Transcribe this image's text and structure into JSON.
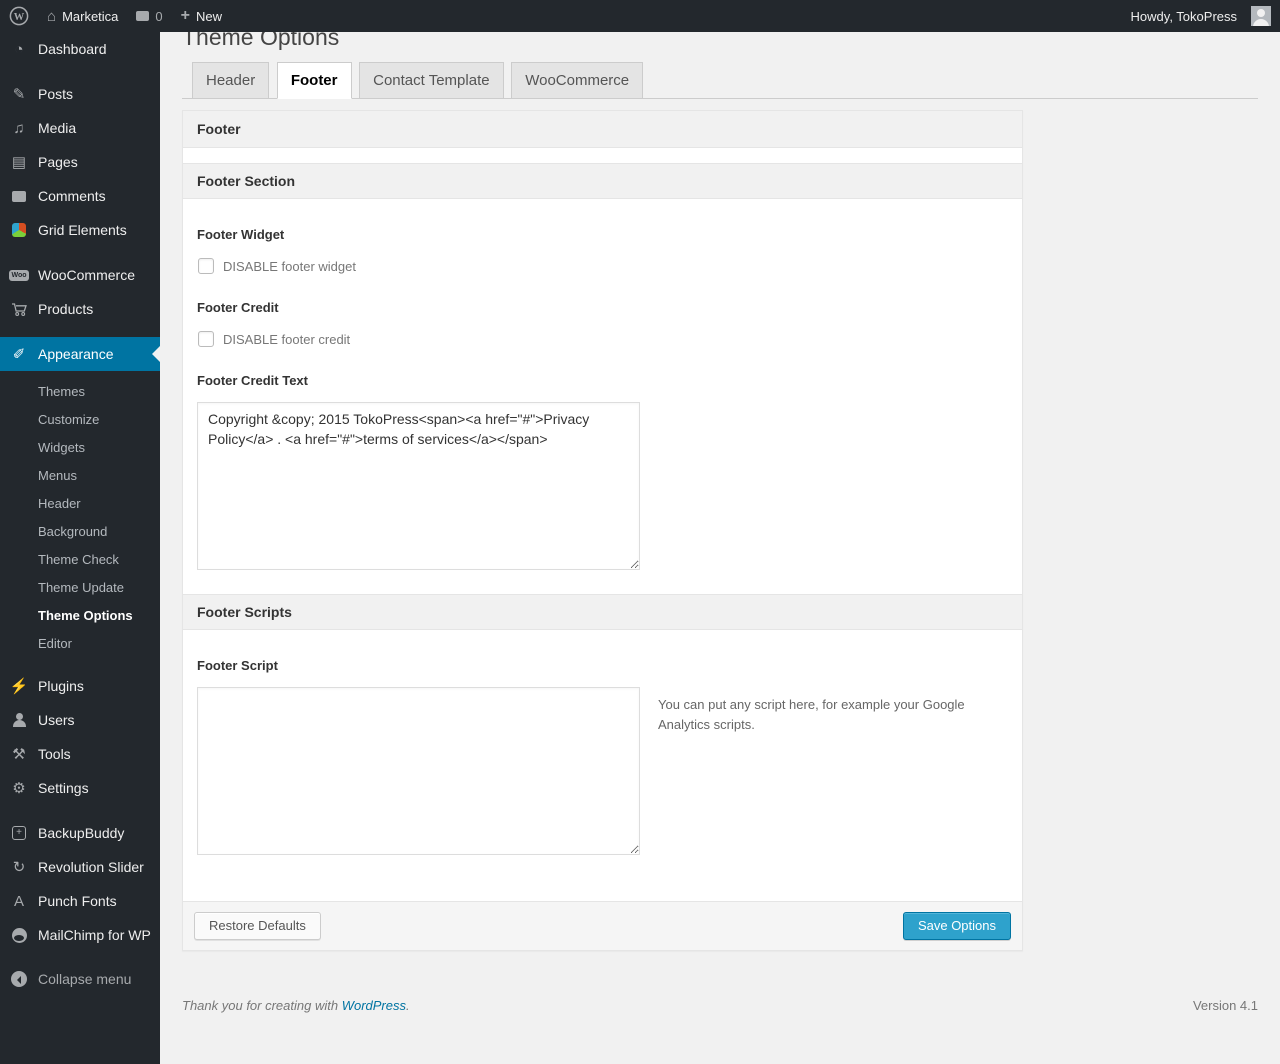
{
  "admin_bar": {
    "wp_logo_letter": "W",
    "site_name": "Marketica",
    "comments_count": "0",
    "new_label": "New",
    "howdy_text": "Howdy, TokoPress"
  },
  "sidebar": {
    "items": [
      {
        "label": "Dashboard"
      },
      {
        "label": "Posts"
      },
      {
        "label": "Media"
      },
      {
        "label": "Pages"
      },
      {
        "label": "Comments"
      },
      {
        "label": "Grid Elements"
      },
      {
        "label": "WooCommerce"
      },
      {
        "label": "Products"
      },
      {
        "label": "Appearance"
      },
      {
        "label": "Plugins"
      },
      {
        "label": "Users"
      },
      {
        "label": "Tools"
      },
      {
        "label": "Settings"
      },
      {
        "label": "BackupBuddy"
      },
      {
        "label": "Revolution Slider"
      },
      {
        "label": "Punch Fonts"
      },
      {
        "label": "MailChimp for WP"
      },
      {
        "label": "Collapse menu"
      }
    ],
    "woo_badge": "Woo",
    "punch_icon_letter": "A",
    "backup_icon_glyph": "+",
    "appearance_submenu": [
      {
        "label": "Themes"
      },
      {
        "label": "Customize"
      },
      {
        "label": "Widgets"
      },
      {
        "label": "Menus"
      },
      {
        "label": "Header"
      },
      {
        "label": "Background"
      },
      {
        "label": "Theme Check"
      },
      {
        "label": "Theme Update"
      },
      {
        "label": "Theme Options"
      },
      {
        "label": "Editor"
      }
    ]
  },
  "page": {
    "title": "Theme Options",
    "tabs": [
      {
        "label": "Header"
      },
      {
        "label": "Footer"
      },
      {
        "label": "Contact Template"
      },
      {
        "label": "WooCommerce"
      }
    ],
    "panel": {
      "header": "Footer",
      "section1_title": "Footer Section",
      "footer_widget_label": "Footer Widget",
      "footer_widget_checkbox": "DISABLE footer widget",
      "footer_credit_label": "Footer Credit",
      "footer_credit_checkbox": "DISABLE footer credit",
      "footer_credit_text_label": "Footer Credit Text",
      "footer_credit_text_value": "Copyright &copy; 2015 TokoPress<span><a href=\"#\">Privacy Policy</a> . <a href=\"#\">terms of services</a></span>",
      "section2_title": "Footer Scripts",
      "footer_script_label": "Footer Script",
      "footer_script_value": "",
      "footer_script_help": "You can put any script here, for example your Google Analytics scripts.",
      "restore_button": "Restore Defaults",
      "save_button": "Save Options"
    }
  },
  "footer": {
    "thanks_prefix": "Thank you for creating with ",
    "wordpress_link": "WordPress",
    "thanks_suffix": ".",
    "version": "Version 4.1"
  },
  "colors": {
    "accent_blue": "#0074a2",
    "button_primary_blue": "#2ea2cc",
    "admin_dark": "#23282d"
  }
}
